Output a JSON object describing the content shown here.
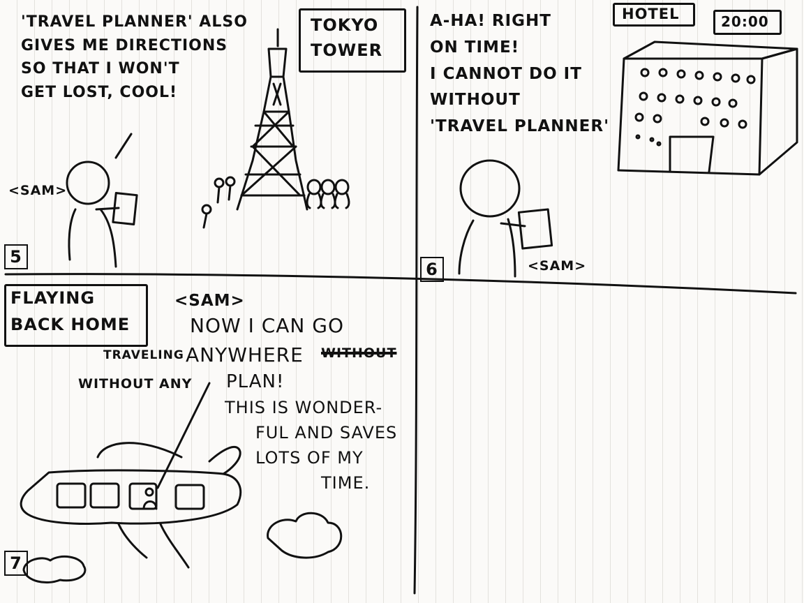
{
  "panel5": {
    "number": "5",
    "speech_lines": [
      "'TRAVEL PLANNER' ALSO",
      "GIVES ME DIRECTIONS",
      "SO THAT I WON'T",
      "GET LOST, COOL!"
    ],
    "place_label_lines": [
      "TOKYO",
      "TOWER"
    ],
    "character_label": "<SAM>"
  },
  "panel6": {
    "number": "6",
    "speech_lines": [
      "A-HA! RIGHT",
      "ON TIME!",
      "I CANNOT DO IT",
      "WITHOUT",
      "'TRAVEL PLANNER'"
    ],
    "place_label": "HOTEL",
    "time_label": "20:00",
    "character_label": "<SAM>"
  },
  "panel7": {
    "number": "7",
    "caption_lines": [
      "FLAYING",
      "BACK HOME"
    ],
    "character_label": "<SAM>",
    "speech_line1": "NOW I CAN GO",
    "inserted_word": "TRAVELING",
    "speech_line2": "ANYWHERE",
    "crossed_word": "WITHOUT",
    "inserted_phrase": "WITHOUT ANY",
    "speech_line3": "PLAN!",
    "speech_lines_rest": [
      "THIS IS WONDER-",
      "FUL AND SAVES",
      "LOTS OF MY",
      "TIME."
    ]
  }
}
